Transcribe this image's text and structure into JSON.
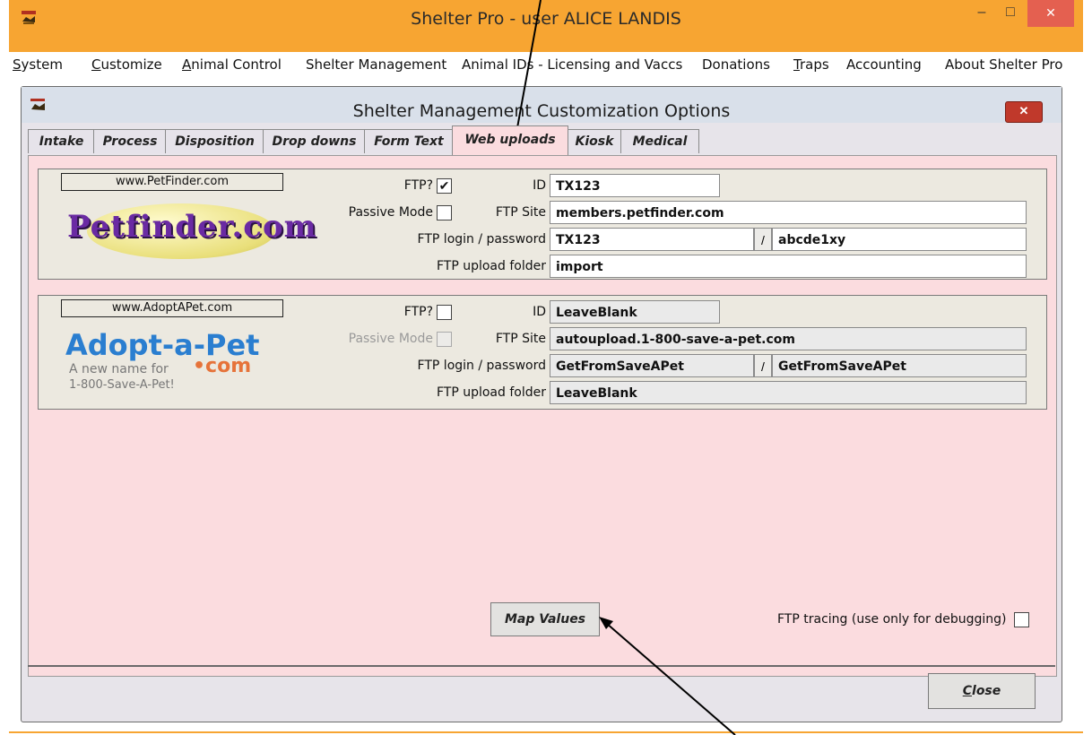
{
  "app": {
    "title": "Shelter Pro - user ALICE LANDIS",
    "minimize": "–",
    "maximize": "□",
    "close": "✕"
  },
  "menu": [
    {
      "u": "S",
      "rest": "ystem"
    },
    {
      "u": "C",
      "rest": "ustomize"
    },
    {
      "u": "A",
      "rest": "nimal Control"
    },
    {
      "u": "",
      "rest": "Shelter Management"
    },
    {
      "u": "",
      "rest": "Animal IDs - Licensing and Vaccs"
    },
    {
      "u": "",
      "rest": "Donations"
    },
    {
      "u": "T",
      "rest": "raps"
    },
    {
      "u": "",
      "rest": "Accounting"
    },
    {
      "u": "",
      "rest": "About Shelter Pro"
    }
  ],
  "dialog": {
    "title": "Shelter Management Customization Options",
    "close": "✕",
    "tabs": [
      "Intake",
      "Process",
      "Disposition",
      "Drop downs",
      "Form Text",
      "Web uploads",
      "Kiosk",
      "Medical"
    ],
    "active_tab": "Web uploads"
  },
  "petfinder": {
    "site": "www.PetFinder.com",
    "logo_text": "Petfinder.com",
    "ftp_label": "FTP?",
    "ftp_checked": true,
    "passive_label": "Passive Mode",
    "passive_checked": false,
    "id_label": "ID",
    "id_value": "TX123",
    "site_label": "FTP Site",
    "site_value": "members.petfinder.com",
    "login_label": "FTP login / password",
    "login_value": "TX123",
    "slash": "/",
    "password_value": "abcde1xy",
    "folder_label": "FTP upload folder",
    "folder_value": "import"
  },
  "adoptapet": {
    "site": "www.AdoptAPet.com",
    "logo_title": "Adopt-a-Pet",
    "logo_line1": "A new name for",
    "logo_com": "•com",
    "logo_line2": "1-800-Save-A-Pet!",
    "ftp_label": "FTP?",
    "ftp_checked": false,
    "passive_label": "Passive Mode",
    "passive_checked": false,
    "id_label": "ID",
    "id_value": "LeaveBlank",
    "site_label": "FTP Site",
    "site_value": "autoupload.1-800-save-a-pet.com",
    "login_label": "FTP login / password",
    "login_value": "GetFromSaveAPet",
    "slash": "/",
    "password_value": "GetFromSaveAPet",
    "folder_label": "FTP upload folder",
    "folder_value": "LeaveBlank"
  },
  "map_values_label": "Map Values",
  "ftp_tracing_label": "FTP tracing (use only for debugging)",
  "ftp_tracing_checked": false,
  "close_button": {
    "u": "C",
    "rest": "lose"
  }
}
